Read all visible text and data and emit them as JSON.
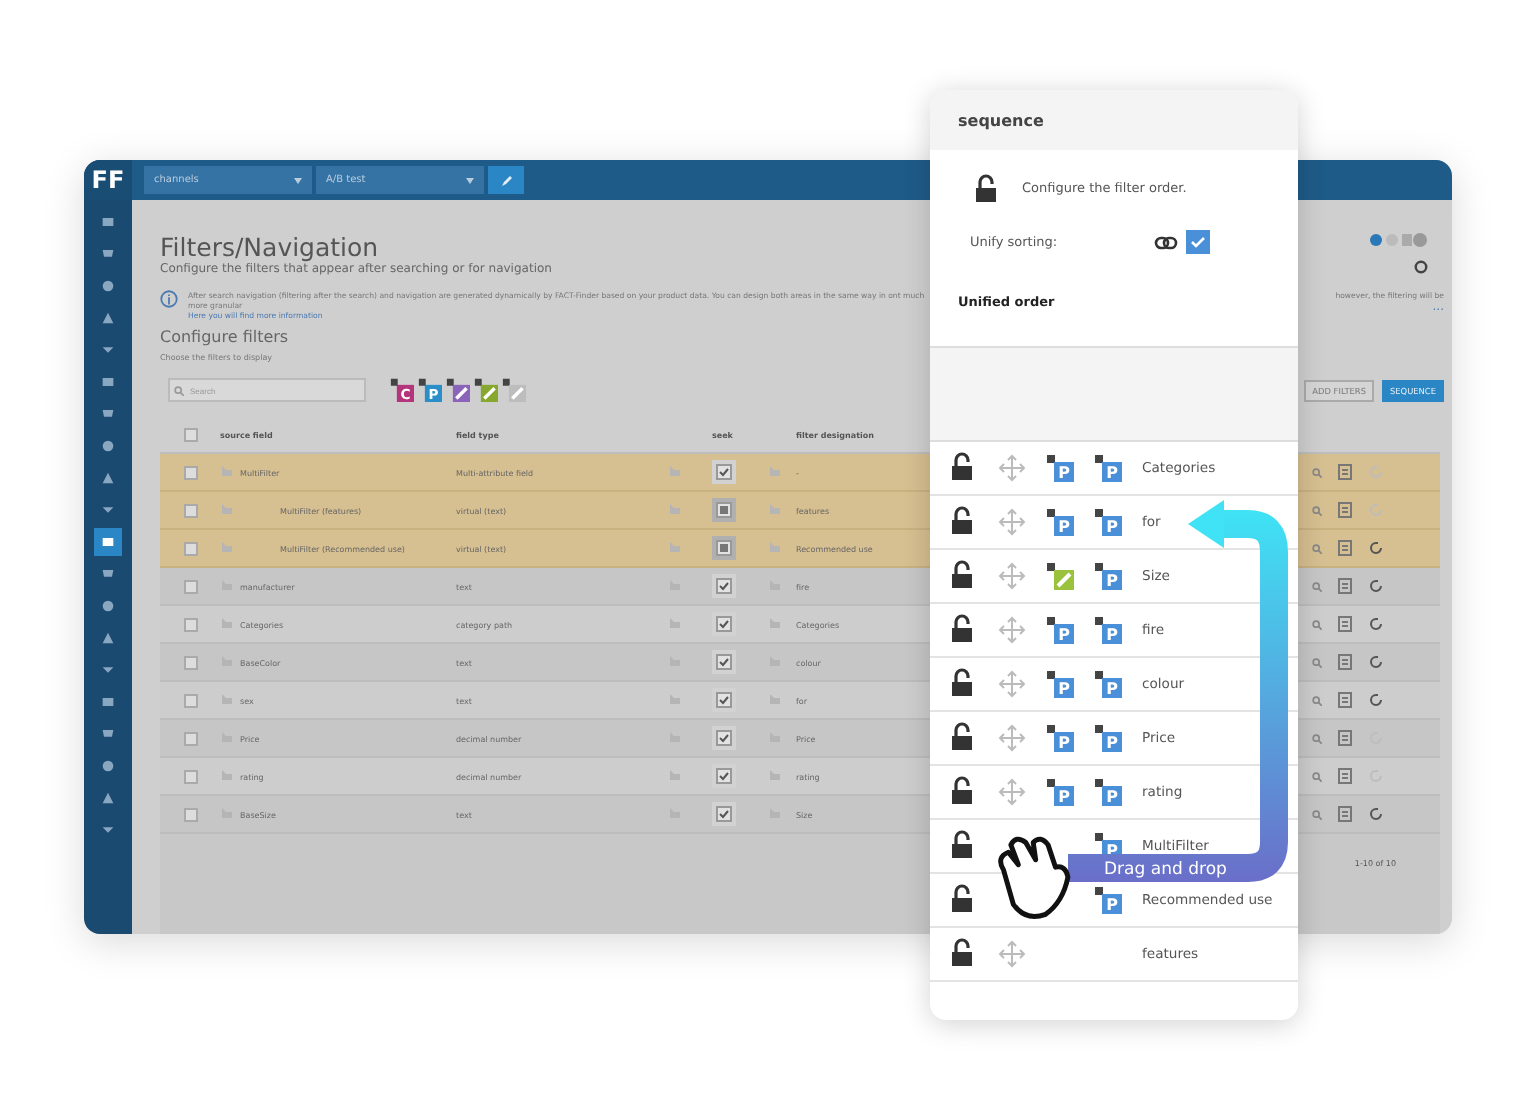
{
  "app": {
    "logo": "FF",
    "header": {
      "dropdowns": [
        {
          "label": "channels"
        },
        {
          "label": "A/B test"
        }
      ]
    },
    "sidebar": {
      "items": [
        {
          "selected": false
        },
        {
          "selected": false
        },
        {
          "selected": false
        },
        {
          "selected": false
        },
        {
          "selected": false
        },
        {
          "selected": false
        },
        {
          "selected": false
        },
        {
          "selected": false
        },
        {
          "selected": false
        },
        {
          "selected": false
        },
        {
          "selected": true
        },
        {
          "selected": false
        },
        {
          "selected": false
        },
        {
          "selected": false
        },
        {
          "selected": false
        },
        {
          "selected": false
        },
        {
          "selected": false
        },
        {
          "selected": false
        },
        {
          "selected": false
        },
        {
          "selected": false
        }
      ]
    },
    "title": "Filters/Navigation",
    "subtitle": "Configure the filters that appear after searching or for navigation",
    "info": {
      "text": "After search navigation (filtering after the search) and navigation are generated dynamically by FACT-Finder based on your product data. You can design both areas in the same way in ont much more granular",
      "link": "Here you will find more information",
      "text_right": "however, the filtering will be",
      "more": "..."
    },
    "section_title": "Configure filters",
    "section_hint": "Choose the filters to display",
    "search": {
      "placeholder": "Search"
    },
    "filter_types": [
      {
        "letter": "C",
        "color": "#b4357c"
      },
      {
        "letter": "P",
        "color": "#2a8fc9"
      },
      {
        "color": "#8b63b8"
      },
      {
        "color": "#86a82e"
      },
      {
        "color": "#bdbdbd"
      }
    ],
    "buttons": [
      {
        "label": "ADD FILTERS",
        "kind": "outline"
      },
      {
        "label": "SEQUENCE",
        "kind": "primary"
      }
    ],
    "table": {
      "columns": [
        "source field",
        "field type",
        "seek",
        "filter designation"
      ],
      "select_all_checked": false,
      "rows": [
        {
          "checked": false,
          "source": "MultiFilter",
          "indent": false,
          "type": "Multi-attribute field",
          "seek_checked": true,
          "seek_partial": false,
          "designation": "-",
          "highlighted": true,
          "reset_enabled": false
        },
        {
          "checked": false,
          "source": "MultiFilter (features)",
          "indent": true,
          "type": "virtual (text)",
          "seek_checked": false,
          "seek_partial": true,
          "designation": "features",
          "highlighted": true,
          "reset_enabled": false
        },
        {
          "checked": false,
          "source": "MultiFilter (Recommended use)",
          "indent": true,
          "type": "virtual (text)",
          "seek_checked": false,
          "seek_partial": true,
          "designation": "Recommended use",
          "highlighted": true,
          "reset_enabled": true
        },
        {
          "checked": false,
          "source": "manufacturer",
          "indent": false,
          "type": "text",
          "seek_checked": true,
          "seek_partial": false,
          "designation": "fire",
          "highlighted": false,
          "reset_enabled": true
        },
        {
          "checked": false,
          "source": "Categories",
          "indent": false,
          "type": "category path",
          "seek_checked": true,
          "seek_partial": false,
          "designation": "Categories",
          "highlighted": false,
          "reset_enabled": true
        },
        {
          "checked": false,
          "source": "BaseColor",
          "indent": false,
          "type": "text",
          "seek_checked": true,
          "seek_partial": false,
          "designation": "colour",
          "highlighted": false,
          "reset_enabled": true
        },
        {
          "checked": false,
          "source": "sex",
          "indent": false,
          "type": "text",
          "seek_checked": true,
          "seek_partial": false,
          "designation": "for",
          "highlighted": false,
          "reset_enabled": true
        },
        {
          "checked": false,
          "source": "Price",
          "indent": false,
          "type": "decimal number",
          "seek_checked": true,
          "seek_partial": false,
          "designation": "Price",
          "highlighted": false,
          "reset_enabled": false
        },
        {
          "checked": false,
          "source": "rating",
          "indent": false,
          "type": "decimal number",
          "seek_checked": true,
          "seek_partial": false,
          "designation": "rating",
          "highlighted": false,
          "reset_enabled": false
        },
        {
          "checked": false,
          "source": "BaseSize",
          "indent": false,
          "type": "text",
          "seek_checked": true,
          "seek_partial": false,
          "designation": "Size",
          "highlighted": false,
          "reset_enabled": true
        }
      ],
      "pagination": "1-10 of 10"
    }
  },
  "sequence_panel": {
    "title": "sequence",
    "description": "Configure the filter order.",
    "unify_label": "Unify sorting:",
    "unify_checked": true,
    "order_title": "Unified order",
    "items": [
      {
        "label": "Categories",
        "cursor_over": false,
        "icons": [
          {
            "letter": "P",
            "color": "#4a90d9"
          },
          {
            "letter": "P",
            "color": "#4a90d9"
          }
        ]
      },
      {
        "label": "for",
        "cursor_over": false,
        "icons": [
          {
            "letter": "P",
            "color": "#4a90d9"
          },
          {
            "letter": "P",
            "color": "#4a90d9"
          }
        ]
      },
      {
        "label": "Size",
        "cursor_over": false,
        "icons": [
          {
            "color": "#9bc23c"
          },
          {
            "letter": "P",
            "color": "#4a90d9"
          }
        ]
      },
      {
        "label": "fire",
        "cursor_over": false,
        "icons": [
          {
            "letter": "P",
            "color": "#4a90d9"
          },
          {
            "letter": "P",
            "color": "#4a90d9"
          }
        ]
      },
      {
        "label": "colour",
        "cursor_over": false,
        "icons": [
          {
            "letter": "P",
            "color": "#4a90d9"
          },
          {
            "letter": "P",
            "color": "#4a90d9"
          }
        ]
      },
      {
        "label": "Price",
        "cursor_over": false,
        "icons": [
          {
            "letter": "P",
            "color": "#4a90d9"
          },
          {
            "letter": "P",
            "color": "#4a90d9"
          }
        ]
      },
      {
        "label": "rating",
        "cursor_over": false,
        "icons": [
          {
            "letter": "P",
            "color": "#4a90d9"
          },
          {
            "letter": "P",
            "color": "#4a90d9"
          }
        ]
      },
      {
        "label": "MultiFilter",
        "cursor_over": true,
        "icons": [
          {
            "letter": "P",
            "color": "#4a90d9"
          }
        ]
      },
      {
        "label": "Recommended use",
        "cursor_over": true,
        "icons": [
          {
            "letter": "P",
            "color": "#4a90d9"
          }
        ]
      },
      {
        "label": "features",
        "cursor_over": false
      }
    ]
  },
  "callout": {
    "text": "Drag and drop"
  }
}
